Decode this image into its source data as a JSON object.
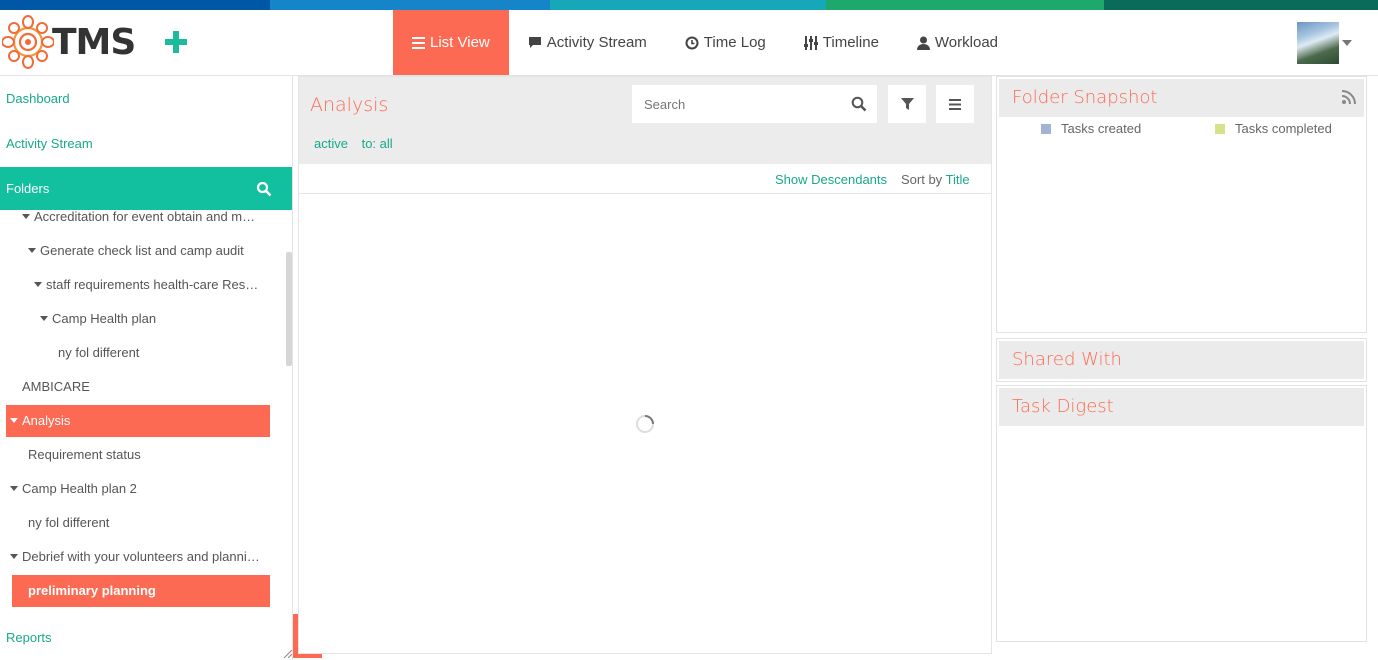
{
  "colors": {
    "accent": "#fd6a53",
    "teal": "#12bf9f",
    "link": "#18a98a",
    "stripe": [
      "#0057a8",
      "#1684c8",
      "#16a7b8",
      "#1fa86b",
      "#0a6b5a"
    ]
  },
  "header": {
    "logo_text": "TMS",
    "add_icon": "plus-icon",
    "nav": [
      {
        "label": "List View",
        "icon": "list-icon",
        "active": true
      },
      {
        "label": "Activity Stream",
        "icon": "comment-icon",
        "active": false
      },
      {
        "label": "Time Log",
        "icon": "clock-icon",
        "active": false
      },
      {
        "label": "Timeline",
        "icon": "sliders-icon",
        "active": false
      },
      {
        "label": "Workload",
        "icon": "user-icon",
        "active": false
      }
    ]
  },
  "sidebar": {
    "dashboard": "Dashboard",
    "activity_stream": "Activity Stream",
    "folders_label": "Folders",
    "reports": "Reports",
    "tree": [
      {
        "label": "Accreditation for event obtain and m…",
        "caret": true,
        "selected": false
      },
      {
        "label": "Generate check list and camp audit",
        "caret": true,
        "selected": false
      },
      {
        "label": "staff requirements health-care Res…",
        "caret": true,
        "selected": false
      },
      {
        "label": "Camp Health plan",
        "caret": true,
        "selected": false
      },
      {
        "label": "ny fol different",
        "caret": false,
        "selected": false
      },
      {
        "label": "AMBICARE",
        "caret": false,
        "selected": false
      },
      {
        "label": "Analysis",
        "caret": true,
        "selected": true
      },
      {
        "label": "Requirement status",
        "caret": false,
        "selected": false
      },
      {
        "label": "Camp Health plan 2",
        "caret": true,
        "selected": false
      },
      {
        "label": "ny fol different",
        "caret": false,
        "selected": false
      },
      {
        "label": "Debrief with your volunteers and planni…",
        "caret": true,
        "selected": false
      },
      {
        "label": "preliminary planning",
        "caret": false,
        "selected": true
      }
    ]
  },
  "main": {
    "title": "Analysis",
    "search_placeholder": "Search",
    "filters": [
      "active",
      "to: all"
    ],
    "show_descendants": "Show Descendants",
    "sort_by_label": "Sort by",
    "sort_by_value": "Title"
  },
  "right": {
    "snapshot_title": "Folder Snapshot",
    "legend": [
      {
        "label": "Tasks created",
        "color": "#a3b3d4"
      },
      {
        "label": "Tasks completed",
        "color": "#d5e38a"
      }
    ],
    "shared_with_title": "Shared With",
    "task_digest_title": "Task Digest"
  }
}
